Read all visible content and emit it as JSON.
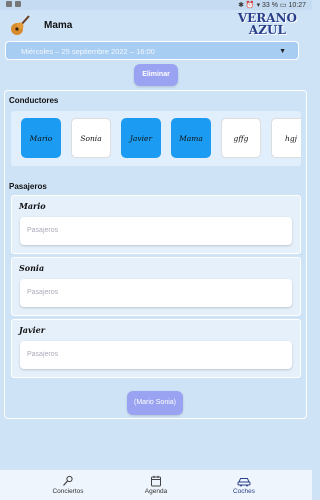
{
  "status": {
    "right": "✱ ⏰ ▾ 33 % ▭ 10:27"
  },
  "header": {
    "title": "Mama",
    "logo_line1": "VERANO",
    "logo_line2": "AZUL"
  },
  "concert_select": {
    "value": "Miércoles – 25 septiembre 2022 – 16:00"
  },
  "actions": {
    "delete_label": "Eliminar",
    "summary_label": "(Mario Sonia)"
  },
  "drivers": {
    "title": "Conductores",
    "items": [
      {
        "label": "Mario",
        "selected": true
      },
      {
        "label": "Sonia",
        "selected": false
      },
      {
        "label": "Javier",
        "selected": true
      },
      {
        "label": "Mama",
        "selected": true
      },
      {
        "label": "gffg",
        "selected": false
      },
      {
        "label": "hgj",
        "selected": false
      }
    ]
  },
  "passengers": {
    "title": "Pasajeros",
    "cards": [
      {
        "driver": "Mario",
        "placeholder": "Pasajeros"
      },
      {
        "driver": "Sonia",
        "placeholder": "Pasajeros"
      },
      {
        "driver": "Javier",
        "placeholder": "Pasajeros"
      }
    ]
  },
  "nav": {
    "items": [
      {
        "label": "Conciertos",
        "icon": "microphone-icon"
      },
      {
        "label": "Agenda",
        "icon": "calendar-icon"
      },
      {
        "label": "Coches",
        "icon": "car-icon"
      }
    ]
  },
  "colors": {
    "selected_driver": "#1b9cf2",
    "accent_button": "#9aa3f2",
    "background": "#cfe3f6"
  }
}
